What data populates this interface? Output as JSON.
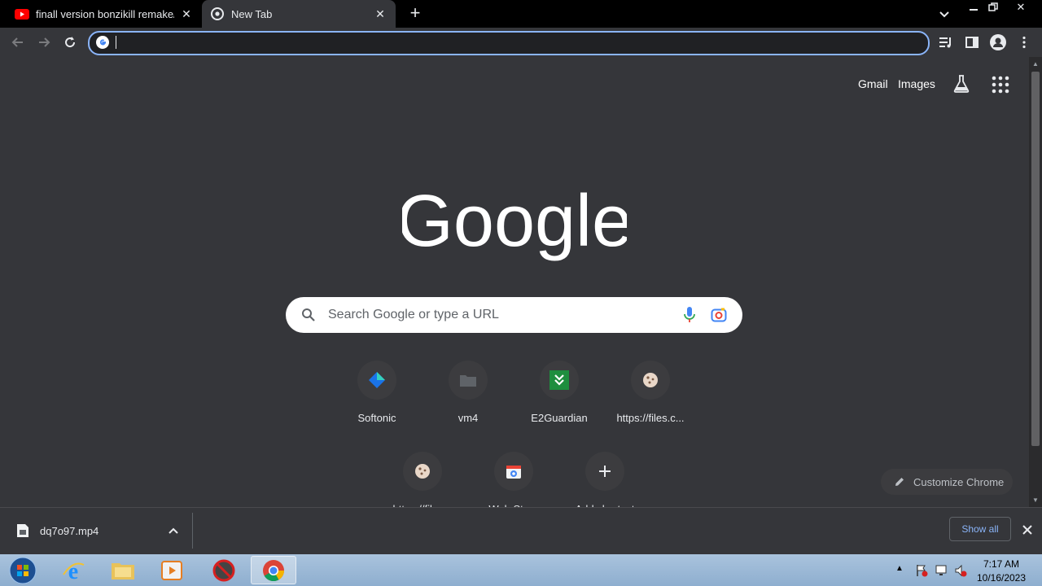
{
  "tabs": [
    {
      "title": "finall version bonzikill remake/ф",
      "favicon": "youtube-icon"
    },
    {
      "title": "New Tab",
      "favicon": "chrome-icon",
      "active": true
    }
  ],
  "omnibox": {
    "value": ""
  },
  "header_links": {
    "gmail": "Gmail",
    "images": "Images"
  },
  "logo_text": "Google",
  "search": {
    "placeholder": "Search Google or type a URL"
  },
  "shortcuts": [
    {
      "label": "Softonic",
      "icon": "softonic-icon"
    },
    {
      "label": "vm4",
      "icon": "folder-icon"
    },
    {
      "label": "E2Guardian",
      "icon": "e2guardian-icon"
    },
    {
      "label": "https://files.c...",
      "icon": "cookie-favicon-icon"
    },
    {
      "label": "https://files...",
      "icon": "cookie-favicon-icon"
    },
    {
      "label": "Web Store",
      "icon": "web-store-icon"
    },
    {
      "label": "Add shortcut",
      "icon": "plus-icon"
    }
  ],
  "customize": {
    "label": "Customize Chrome"
  },
  "download": {
    "filename": "dq7o97.mp4",
    "show_all": "Show all"
  },
  "taskbar": {
    "time": "7:17 AM",
    "date": "10/16/2023"
  },
  "colors": {
    "accent": "#8ab4f8",
    "background": "#35363a",
    "tabstrip": "#000000"
  }
}
